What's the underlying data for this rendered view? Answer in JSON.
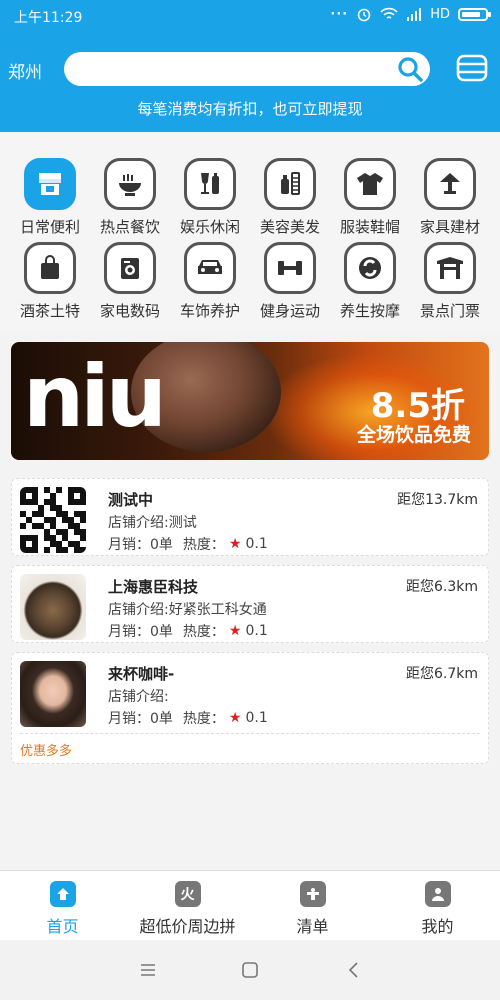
{
  "status_bar": {
    "time": "上午11:29",
    "network": "HD"
  },
  "header": {
    "city": "郑州",
    "search_placeholder": "",
    "subtitle": "每笔消费均有折扣，也可立即提现"
  },
  "categories": [
    {
      "label": "日常便利",
      "icon": "store-icon"
    },
    {
      "label": "热点餐饮",
      "icon": "bowl-icon"
    },
    {
      "label": "娱乐休闲",
      "icon": "drinks-icon"
    },
    {
      "label": "美容美发",
      "icon": "cosmetics-icon"
    },
    {
      "label": "服装鞋帽",
      "icon": "shirt-icon"
    },
    {
      "label": "家具建材",
      "icon": "lamp-icon"
    },
    {
      "label": "酒茶土特",
      "icon": "bag-icon"
    },
    {
      "label": "家电数码",
      "icon": "washer-icon"
    },
    {
      "label": "车饰养护",
      "icon": "car-icon"
    },
    {
      "label": "健身运动",
      "icon": "dumbbell-icon"
    },
    {
      "label": "养生按摩",
      "icon": "swirl-icon"
    },
    {
      "label": "景点门票",
      "icon": "gate-icon"
    }
  ],
  "banner": {
    "brand": "niu",
    "discount": "8.5折",
    "promo": "全场饮品免费"
  },
  "shops": [
    {
      "name": "测试中",
      "distance": "距您13.7km",
      "intro": "店铺介绍:测试",
      "sales": "月销：0单",
      "heat_label": "热度：",
      "heat": "0.1",
      "thumb": "qr-code"
    },
    {
      "name": "上海惠臣科技",
      "distance": "距您6.3km",
      "intro": "店铺介绍:好紧张工科女通",
      "sales": "月销：0单",
      "heat_label": "热度：",
      "heat": "0.1",
      "thumb": "food-photo"
    },
    {
      "name": "来杯咖啡-",
      "distance": "距您6.7km",
      "intro": "店铺介绍:",
      "sales": "月销：0单",
      "heat_label": "热度：",
      "heat": "0.1",
      "thumb": "person-photo",
      "offer": "优惠多多"
    }
  ],
  "tabs": [
    {
      "label": "首页",
      "icon": "home-icon",
      "glyph": ""
    },
    {
      "label": "超低价周边拼",
      "icon": "fire-icon",
      "glyph": "火"
    },
    {
      "label": "清单",
      "icon": "list-icon",
      "glyph": ""
    },
    {
      "label": "我的",
      "icon": "user-icon",
      "glyph": ""
    }
  ],
  "colors": {
    "accent": "#1aa3e6",
    "star": "#e02020",
    "offer": "#e07a2a"
  }
}
